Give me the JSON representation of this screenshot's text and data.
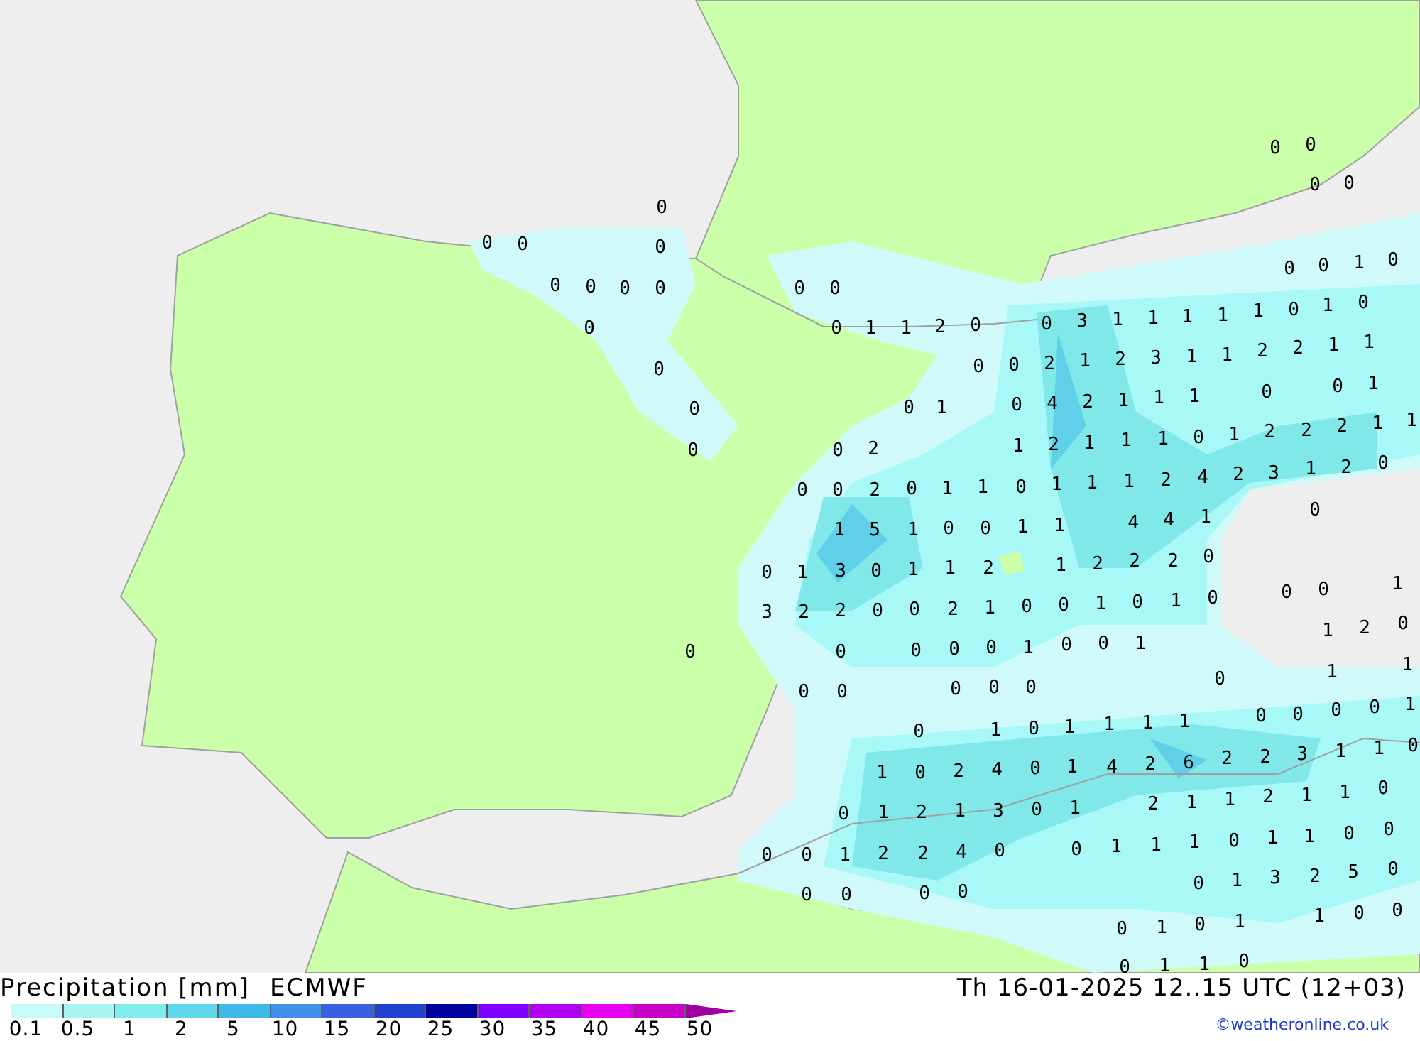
{
  "map": {
    "precipitation_values": [
      "0",
      "0",
      "0",
      "0",
      "0",
      "0",
      "0",
      "0",
      "0",
      "0",
      "0",
      "0",
      "0",
      "0",
      "0",
      "1",
      "1",
      "2",
      "0",
      "1",
      "0",
      "0",
      "0",
      "0",
      "0",
      "0",
      "1",
      "0",
      "0",
      "0",
      "3",
      "1",
      "1",
      "1",
      "1",
      "1",
      "0",
      "1",
      "0",
      "0",
      "0",
      "2",
      "1",
      "2",
      "3",
      "1",
      "1",
      "2",
      "2",
      "1",
      "1",
      "0",
      "0",
      "1",
      "0",
      "4",
      "2",
      "1",
      "1",
      "1",
      "0",
      "2",
      "1",
      "2",
      "0",
      "0",
      "2",
      "0",
      "1",
      "1",
      "0",
      "1",
      "1",
      "5",
      "1",
      "0",
      "0",
      "1",
      "1",
      "0",
      "1",
      "3",
      "0",
      "1",
      "1",
      "2",
      "1",
      "3",
      "2",
      "2",
      "0",
      "0",
      "2",
      "1",
      "0",
      "0",
      "0",
      "0",
      "0",
      "0",
      "1",
      "0",
      "0",
      "0",
      "0",
      "0",
      "0",
      "0",
      "1",
      "1",
      "1",
      "0",
      "1",
      "2",
      "2",
      "2",
      "1",
      "1",
      "1",
      "1",
      "2",
      "4",
      "2",
      "3",
      "1",
      "2",
      "0",
      "4",
      "4",
      "1",
      "0",
      "2",
      "2",
      "2",
      "0",
      "1",
      "0",
      "1",
      "0",
      "0",
      "0",
      "1",
      "0",
      "1",
      "1",
      "2",
      "0",
      "0",
      "1",
      "1",
      "0",
      "1",
      "0",
      "1",
      "1",
      "0",
      "2",
      "4",
      "0",
      "1",
      "0",
      "1",
      "2",
      "1",
      "3",
      "0",
      "1",
      "0",
      "0",
      "1",
      "2",
      "2",
      "4",
      "0",
      "0",
      "0",
      "0",
      "0",
      "0",
      "1",
      "1",
      "1",
      "0",
      "0",
      "0",
      "0",
      "1",
      "4",
      "2",
      "6",
      "2",
      "2",
      "3",
      "1",
      "1",
      "0",
      "2",
      "1",
      "1",
      "2",
      "1",
      "1",
      "0",
      "1",
      "1",
      "1",
      "0",
      "1",
      "1",
      "0",
      "0",
      "0",
      "1",
      "3",
      "2",
      "5",
      "0",
      "0",
      "1",
      "0",
      "1",
      "1",
      "0",
      "0",
      "0",
      "1",
      "1",
      "0"
    ]
  },
  "footer": {
    "title": "Precipitation [mm]",
    "model": "ECMWF",
    "valid_time": "Th 16-01-2025 12..15 UTC (12+03)",
    "credit": "©weatheronline.co.uk"
  },
  "legend": {
    "swatches": [
      {
        "kind": "bar",
        "color": "#c8fafa"
      },
      {
        "kind": "bar",
        "color": "#a8f4f4"
      },
      {
        "kind": "bar",
        "color": "#80ecec"
      },
      {
        "kind": "bar",
        "color": "#60d8ec"
      },
      {
        "kind": "bar",
        "color": "#40b8e8"
      },
      {
        "kind": "bar",
        "color": "#4090e8"
      },
      {
        "kind": "bar",
        "color": "#3860e0"
      },
      {
        "kind": "bar",
        "color": "#2040d0"
      },
      {
        "kind": "bar",
        "color": "#0000a0"
      },
      {
        "kind": "bar",
        "color": "#8000ff"
      },
      {
        "kind": "bar",
        "color": "#b000f0"
      },
      {
        "kind": "bar",
        "color": "#e800f0"
      },
      {
        "kind": "bar",
        "color": "#c800c8"
      },
      {
        "kind": "arrow",
        "color": "#a000a0"
      }
    ],
    "labels": [
      "0.1",
      "0.5",
      "1",
      "2",
      "5",
      "10",
      "15",
      "20",
      "25",
      "30",
      "35",
      "40",
      "45",
      "50"
    ]
  }
}
